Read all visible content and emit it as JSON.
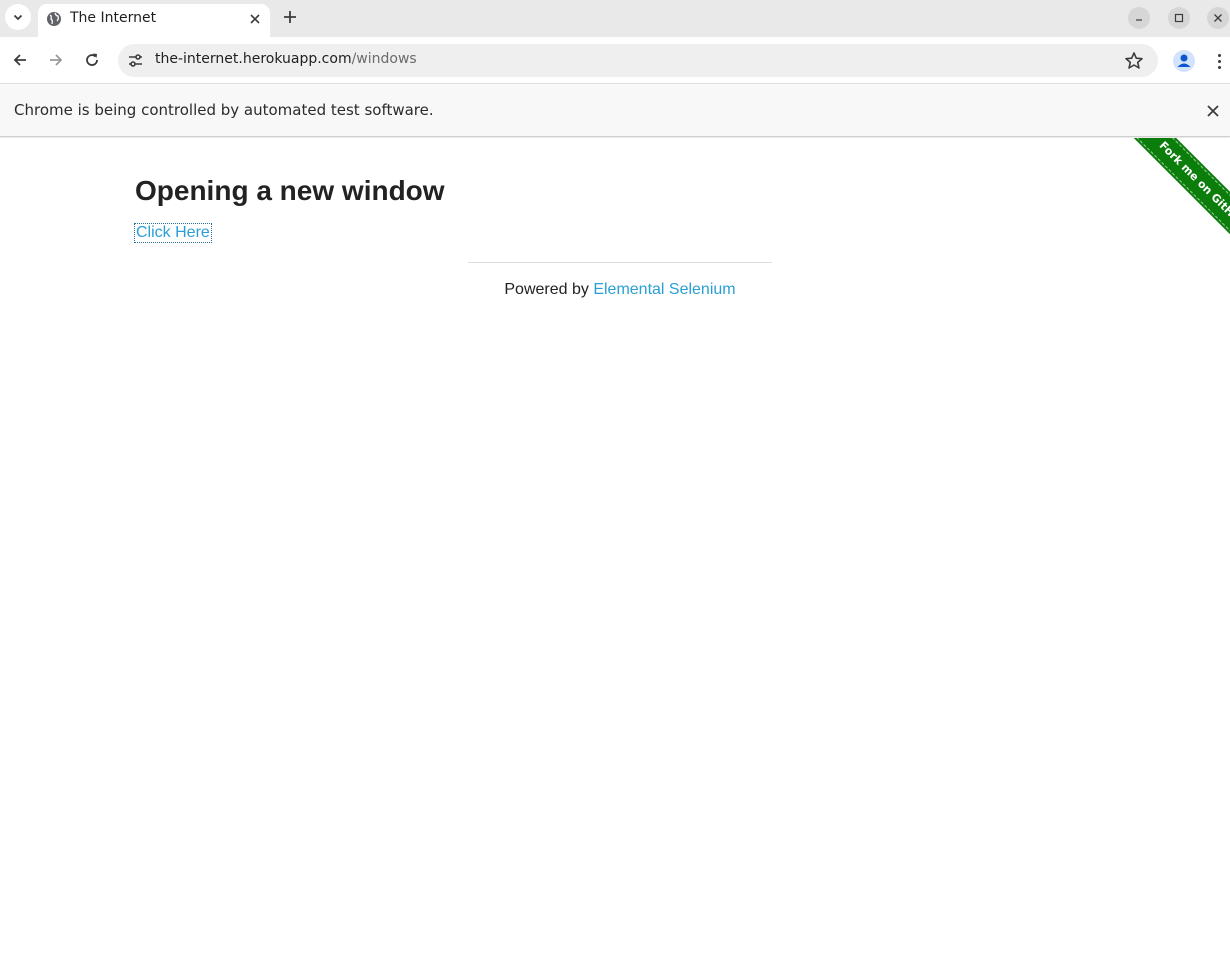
{
  "browser": {
    "tab": {
      "title": "The Internet",
      "favicon": "globe-icon"
    },
    "address_bar": {
      "host": "the-internet.herokuapp.com",
      "path": "/windows"
    },
    "infobar": {
      "message": "Chrome is being controlled by automated test software."
    },
    "icons": {
      "tab_search": "chevron-down-icon",
      "tab_close": "close-icon",
      "new_tab": "plus-icon",
      "minimize": "minimize-icon",
      "maximize": "maximize-icon",
      "window_close": "close-icon",
      "back": "arrow-left-icon",
      "forward": "arrow-right-icon",
      "reload": "reload-icon",
      "site_info": "tune-icon",
      "bookmark": "star-icon",
      "profile": "person-icon",
      "menu": "kebab-icon"
    }
  },
  "page": {
    "title": "Opening a new window",
    "link_label": "Click Here",
    "footer": {
      "prefix": "Powered by ",
      "link_label": "Elemental Selenium"
    },
    "ribbon": {
      "label": "Fork me on GitHub",
      "color": "#0a7d0a"
    },
    "link_color": "#2a9fd6"
  }
}
